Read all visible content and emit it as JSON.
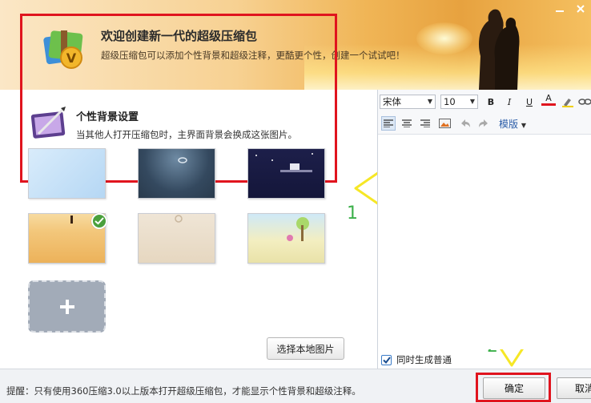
{
  "header": {
    "title": "欢迎创建新一代的超级压缩包",
    "subtitle": "超级压缩包可以添加个性背景和超级注释，更酷更个性，创建一个试试吧！"
  },
  "background_section": {
    "title": "个性背景设置",
    "description": "当其他人打开压缩包时，主界面背景会换成这张图片。",
    "selected_index": 3,
    "thumbnails": [
      {
        "name": "light-blue"
      },
      {
        "name": "dark-slate-ring"
      },
      {
        "name": "night-figure"
      },
      {
        "name": "orange-sunset-couple"
      },
      {
        "name": "beige-ring"
      },
      {
        "name": "cartoon-beach"
      }
    ],
    "local_image_button": "选择本地图片"
  },
  "editor": {
    "font_family": "宋体",
    "font_size": "10",
    "bold": "B",
    "italic": "I",
    "underline": "U",
    "font_color": "A",
    "template_label": "模版"
  },
  "checkbox": {
    "checked": true,
    "label": "同时生成普通"
  },
  "footer": {
    "tip": "提醒：只有使用360压缩3.0以上版本打开超级压缩包，才能显示个性背景和超级注释。",
    "ok_label": "确定",
    "cancel_label": "取消"
  },
  "annotations": {
    "step1": "1",
    "step2": "2"
  },
  "colors": {
    "highlight_red": "#e0141e",
    "arrow_yellow": "#f6e726",
    "annotation_green": "#3cb04a",
    "check_green": "#4aa03c"
  }
}
